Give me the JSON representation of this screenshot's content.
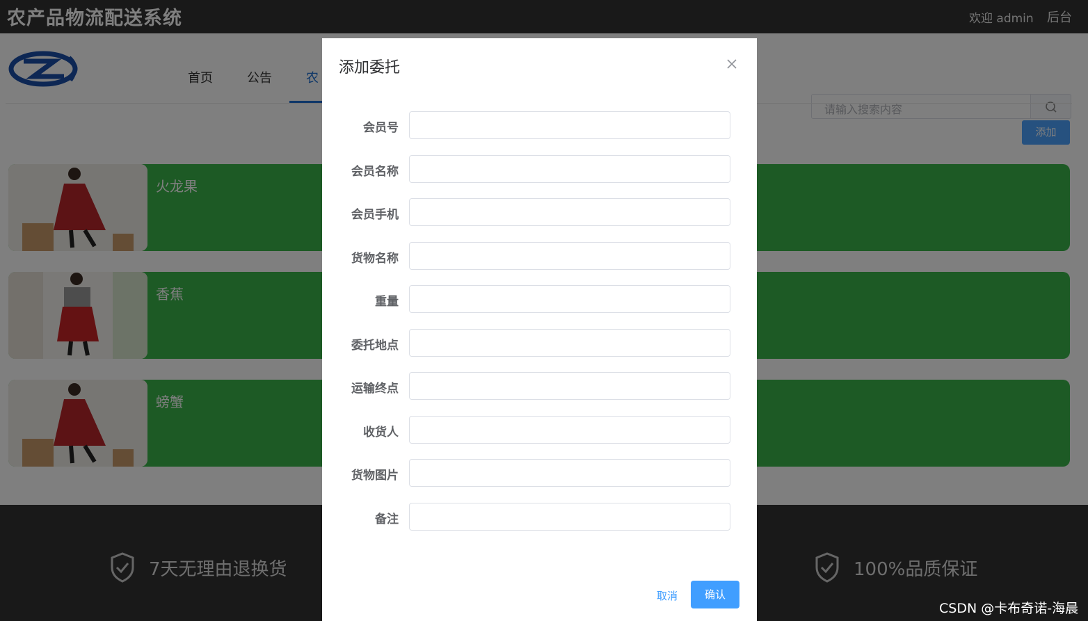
{
  "header": {
    "site_title": "农产品物流配送系统",
    "welcome": "欢迎 admin",
    "admin_link": "后台"
  },
  "nav": {
    "items": [
      {
        "label": "首页"
      },
      {
        "label": "公告"
      },
      {
        "label": "农"
      }
    ],
    "active_index": 2
  },
  "search": {
    "placeholder": "请输入搜索内容",
    "icon": "search-icon"
  },
  "content": {
    "add_button": "添加",
    "products": [
      {
        "name": "火龙果"
      },
      {
        "name": "香蕉"
      },
      {
        "name": "螃蟹"
      }
    ]
  },
  "footer": {
    "guarantees": [
      {
        "text": "7天无理由退换货",
        "icon": "shield-check-icon"
      },
      {
        "text": "100%品质保证",
        "icon": "shield-check-icon"
      }
    ],
    "watermark": "CSDN @卡布奇诺-海晨"
  },
  "dialog": {
    "title": "添加委托",
    "fields": [
      {
        "label": "会员号",
        "value": ""
      },
      {
        "label": "会员名称",
        "value": ""
      },
      {
        "label": "会员手机",
        "value": ""
      },
      {
        "label": "货物名称",
        "value": ""
      },
      {
        "label": "重量",
        "value": ""
      },
      {
        "label": "委托地点",
        "value": ""
      },
      {
        "label": "运输终点",
        "value": ""
      },
      {
        "label": "收货人",
        "value": ""
      },
      {
        "label": "货物图片",
        "value": ""
      },
      {
        "label": "备注",
        "value": ""
      }
    ],
    "cancel_label": "取消",
    "confirm_label": "确认"
  },
  "colors": {
    "accent": "#409eff",
    "card": "#3bb54a",
    "topbar": "#333333"
  }
}
